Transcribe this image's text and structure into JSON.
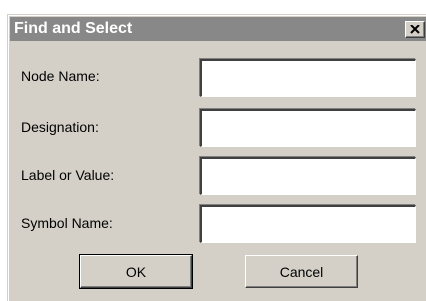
{
  "dialog": {
    "title": "Find and Select",
    "close_glyph": "close-icon"
  },
  "fields": [
    {
      "label": "Node Name:",
      "value": "",
      "placeholder": ""
    },
    {
      "label": "Designation:",
      "value": "",
      "placeholder": ""
    },
    {
      "label": "Label or Value:",
      "value": "",
      "placeholder": ""
    },
    {
      "label": "Symbol Name:",
      "value": "",
      "placeholder": ""
    }
  ],
  "buttons": {
    "ok_label": "OK",
    "cancel_label": "Cancel"
  },
  "colors": {
    "titlebar": "#888888",
    "dialog_face": "#d4d0c8",
    "title_text": "#ffffff"
  }
}
